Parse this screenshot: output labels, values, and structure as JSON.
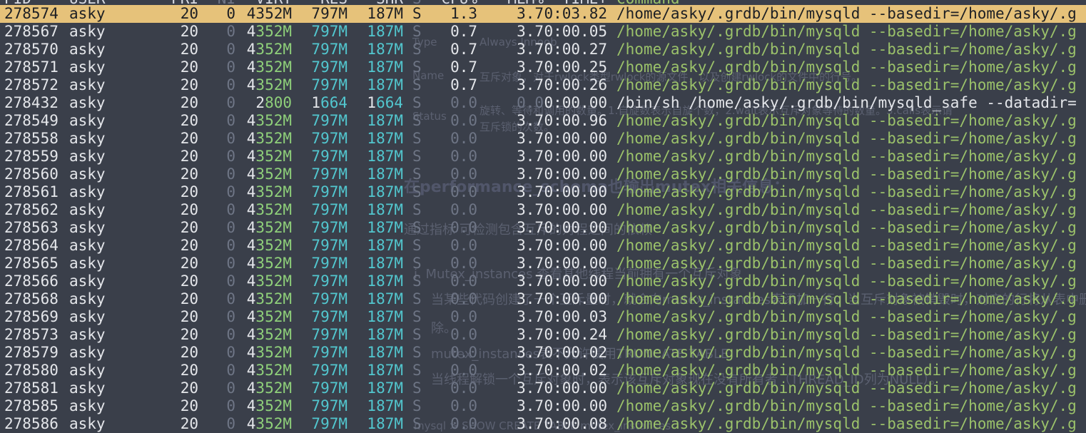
{
  "header": {
    "columns": [
      "PID",
      "USER",
      "PRI",
      "NI",
      "VIRT",
      "RES",
      "SHR",
      "S",
      "CPU%",
      "MEM%",
      "TIME+",
      "Command"
    ]
  },
  "colors": {
    "background": "#3a3f4a",
    "selected_row": "#e6c27a",
    "command_green": "#9bc26a",
    "res_cyan": "#52c7cf",
    "virt_green": "#8fd07a"
  },
  "background_document": {
    "type_label": "Type",
    "type_value": "Always Innoob",
    "name_label": "Name",
    "name_value": "互斥对象，对于rwlock类型rwlock的源文件，以及创建rwlock的文件中的行号。",
    "status_label": "Status",
    "status_line1": "旋转、等待和调用的数量。1.自旋数表示自旋个数，2.wait表示互斥对象等待的数量。3.calls表示请",
    "status_line2": "互斥锁的次数。",
    "heading": "在performance_schema也输出mutex相关信息：",
    "intro": "通过指标 可检测包含互斥的对程之间的依赖",
    "item1": "i. Mutex_instances 查看其他线程当前拥有一个互斥对象",
    "item1_desc1": "当某些代码创建了一个互斥量时，就会向mutex_instances表添加一行，当互斥对象被销毁时，对应的行将从表中删",
    "item1_desc2": "除。",
    "item2": "mutex_instances表不允许使用TRUNCATE TABLE",
    "item2_desc": "当线程解锁一个互斥对象时，表示该互斥对象现在没有所有者（THREAD_ID列为NULL）。",
    "footer": "mysql > SHOW CREATE TABLE mutex_instances"
  },
  "processes": [
    {
      "pid": "278574",
      "user": "asky",
      "pri": "20",
      "ni": "0",
      "virt": "4352M",
      "res": "797M",
      "shr": "187M",
      "s": "S",
      "cpu": "1.3",
      "mem": "3.7",
      "time": "0:03.82",
      "cmd": "/home/asky/.grdb/bin/mysqld --basedir=/home/asky/.g",
      "selected": true
    },
    {
      "pid": "278567",
      "user": "asky",
      "pri": "20",
      "ni": "0",
      "virt": "4352M",
      "res": "797M",
      "shr": "187M",
      "s": "S",
      "cpu": "0.7",
      "mem": "3.7",
      "time": "0:00.05",
      "cmd": "/home/asky/.grdb/bin/mysqld --basedir=/home/asky/.g"
    },
    {
      "pid": "278570",
      "user": "asky",
      "pri": "20",
      "ni": "0",
      "virt": "4352M",
      "res": "797M",
      "shr": "187M",
      "s": "S",
      "cpu": "0.7",
      "mem": "3.7",
      "time": "0:00.27",
      "cmd": "/home/asky/.grdb/bin/mysqld --basedir=/home/asky/.g"
    },
    {
      "pid": "278571",
      "user": "asky",
      "pri": "20",
      "ni": "0",
      "virt": "4352M",
      "res": "797M",
      "shr": "187M",
      "s": "S",
      "cpu": "0.7",
      "mem": "3.7",
      "time": "0:00.25",
      "cmd": "/home/asky/.grdb/bin/mysqld --basedir=/home/asky/.g"
    },
    {
      "pid": "278572",
      "user": "asky",
      "pri": "20",
      "ni": "0",
      "virt": "4352M",
      "res": "797M",
      "shr": "187M",
      "s": "S",
      "cpu": "0.7",
      "mem": "3.7",
      "time": "0:00.26",
      "cmd": "/home/asky/.grdb/bin/mysqld --basedir=/home/asky/.g"
    },
    {
      "pid": "278432",
      "user": "asky",
      "pri": "20",
      "ni": "0",
      "virt": "2800",
      "res": "1664",
      "shr": "1664",
      "s": "S",
      "cpu": "0.0",
      "mem": "0.0",
      "time": "0:00.00",
      "cmd": "/bin/sh /home/asky/.grdb/bin/mysqld_safe --datadir=",
      "bright": true
    },
    {
      "pid": "278549",
      "user": "asky",
      "pri": "20",
      "ni": "0",
      "virt": "4352M",
      "res": "797M",
      "shr": "187M",
      "s": "S",
      "cpu": "0.0",
      "mem": "3.7",
      "time": "0:00.96",
      "cmd": "/home/asky/.grdb/bin/mysqld --basedir=/home/asky/.g"
    },
    {
      "pid": "278558",
      "user": "asky",
      "pri": "20",
      "ni": "0",
      "virt": "4352M",
      "res": "797M",
      "shr": "187M",
      "s": "S",
      "cpu": "0.0",
      "mem": "3.7",
      "time": "0:00.00",
      "cmd": "/home/asky/.grdb/bin/mysqld --basedir=/home/asky/.g"
    },
    {
      "pid": "278559",
      "user": "asky",
      "pri": "20",
      "ni": "0",
      "virt": "4352M",
      "res": "797M",
      "shr": "187M",
      "s": "S",
      "cpu": "0.0",
      "mem": "3.7",
      "time": "0:00.00",
      "cmd": "/home/asky/.grdb/bin/mysqld --basedir=/home/asky/.g"
    },
    {
      "pid": "278560",
      "user": "asky",
      "pri": "20",
      "ni": "0",
      "virt": "4352M",
      "res": "797M",
      "shr": "187M",
      "s": "S",
      "cpu": "0.0",
      "mem": "3.7",
      "time": "0:00.00",
      "cmd": "/home/asky/.grdb/bin/mysqld --basedir=/home/asky/.g"
    },
    {
      "pid": "278561",
      "user": "asky",
      "pri": "20",
      "ni": "0",
      "virt": "4352M",
      "res": "797M",
      "shr": "187M",
      "s": "S",
      "cpu": "0.0",
      "mem": "3.7",
      "time": "0:00.00",
      "cmd": "/home/asky/.grdb/bin/mysqld --basedir=/home/asky/.g"
    },
    {
      "pid": "278562",
      "user": "asky",
      "pri": "20",
      "ni": "0",
      "virt": "4352M",
      "res": "797M",
      "shr": "187M",
      "s": "S",
      "cpu": "0.0",
      "mem": "3.7",
      "time": "0:00.00",
      "cmd": "/home/asky/.grdb/bin/mysqld --basedir=/home/asky/.g"
    },
    {
      "pid": "278563",
      "user": "asky",
      "pri": "20",
      "ni": "0",
      "virt": "4352M",
      "res": "797M",
      "shr": "187M",
      "s": "S",
      "cpu": "0.0",
      "mem": "3.7",
      "time": "0:00.00",
      "cmd": "/home/asky/.grdb/bin/mysqld --basedir=/home/asky/.g"
    },
    {
      "pid": "278564",
      "user": "asky",
      "pri": "20",
      "ni": "0",
      "virt": "4352M",
      "res": "797M",
      "shr": "187M",
      "s": "S",
      "cpu": "0.0",
      "mem": "3.7",
      "time": "0:00.00",
      "cmd": "/home/asky/.grdb/bin/mysqld --basedir=/home/asky/.g"
    },
    {
      "pid": "278565",
      "user": "asky",
      "pri": "20",
      "ni": "0",
      "virt": "4352M",
      "res": "797M",
      "shr": "187M",
      "s": "S",
      "cpu": "0.0",
      "mem": "3.7",
      "time": "0:00.00",
      "cmd": "/home/asky/.grdb/bin/mysqld --basedir=/home/asky/.g"
    },
    {
      "pid": "278566",
      "user": "asky",
      "pri": "20",
      "ni": "0",
      "virt": "4352M",
      "res": "797M",
      "shr": "187M",
      "s": "S",
      "cpu": "0.0",
      "mem": "3.7",
      "time": "0:00.00",
      "cmd": "/home/asky/.grdb/bin/mysqld --basedir=/home/asky/.g"
    },
    {
      "pid": "278568",
      "user": "asky",
      "pri": "20",
      "ni": "0",
      "virt": "4352M",
      "res": "797M",
      "shr": "187M",
      "s": "S",
      "cpu": "0.0",
      "mem": "3.7",
      "time": "0:00.00",
      "cmd": "/home/asky/.grdb/bin/mysqld --basedir=/home/asky/.g"
    },
    {
      "pid": "278569",
      "user": "asky",
      "pri": "20",
      "ni": "0",
      "virt": "4352M",
      "res": "797M",
      "shr": "187M",
      "s": "S",
      "cpu": "0.0",
      "mem": "3.7",
      "time": "0:00.03",
      "cmd": "/home/asky/.grdb/bin/mysqld --basedir=/home/asky/.g"
    },
    {
      "pid": "278573",
      "user": "asky",
      "pri": "20",
      "ni": "0",
      "virt": "4352M",
      "res": "797M",
      "shr": "187M",
      "s": "S",
      "cpu": "0.0",
      "mem": "3.7",
      "time": "0:00.24",
      "cmd": "/home/asky/.grdb/bin/mysqld --basedir=/home/asky/.g"
    },
    {
      "pid": "278579",
      "user": "asky",
      "pri": "20",
      "ni": "0",
      "virt": "4352M",
      "res": "797M",
      "shr": "187M",
      "s": "S",
      "cpu": "0.0",
      "mem": "3.7",
      "time": "0:00.02",
      "cmd": "/home/asky/.grdb/bin/mysqld --basedir=/home/asky/.g"
    },
    {
      "pid": "278580",
      "user": "asky",
      "pri": "20",
      "ni": "0",
      "virt": "4352M",
      "res": "797M",
      "shr": "187M",
      "s": "S",
      "cpu": "0.0",
      "mem": "3.7",
      "time": "0:00.02",
      "cmd": "/home/asky/.grdb/bin/mysqld --basedir=/home/asky/.g"
    },
    {
      "pid": "278581",
      "user": "asky",
      "pri": "20",
      "ni": "0",
      "virt": "4352M",
      "res": "797M",
      "shr": "187M",
      "s": "S",
      "cpu": "0.0",
      "mem": "3.7",
      "time": "0:00.00",
      "cmd": "/home/asky/.grdb/bin/mysqld --basedir=/home/asky/.g"
    },
    {
      "pid": "278585",
      "user": "asky",
      "pri": "20",
      "ni": "0",
      "virt": "4352M",
      "res": "797M",
      "shr": "187M",
      "s": "S",
      "cpu": "0.0",
      "mem": "3.7",
      "time": "0:00.00",
      "cmd": "/home/asky/.grdb/bin/mysqld --basedir=/home/asky/.g"
    },
    {
      "pid": "278586",
      "user": "asky",
      "pri": "20",
      "ni": "0",
      "virt": "4352M",
      "res": "797M",
      "shr": "187M",
      "s": "S",
      "cpu": "0.0",
      "mem": "3.7",
      "time": "0:00.08",
      "cmd": "/home/asky/.grdb/bin/mysqld --basedir=/home/asky/.g"
    }
  ]
}
